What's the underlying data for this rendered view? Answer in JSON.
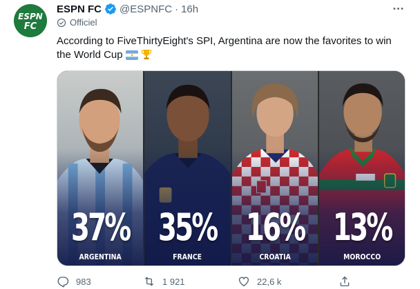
{
  "account": {
    "display_name": "ESPN FC",
    "handle": "@ESPNFC",
    "separator": "·",
    "time": "16h",
    "label": "Officiel",
    "avatar_text_top": "ESPN",
    "avatar_text_bottom": "FC"
  },
  "tweet": {
    "text": "According to FiveThirtyEight's SPI, Argentina are now the favorites to win the World Cup",
    "emojis": [
      "argentina-flag",
      "trophy"
    ]
  },
  "media": {
    "panels": [
      {
        "country": "ARGENTINA",
        "percent": "37%"
      },
      {
        "country": "FRANCE",
        "percent": "35%"
      },
      {
        "country": "CROATIA",
        "percent": "16%"
      },
      {
        "country": "MOROCCO",
        "percent": "13%"
      }
    ]
  },
  "actions": {
    "replies": "983",
    "retweets": "1 921",
    "likes": "22,6 k"
  },
  "colors": {
    "text": "#0f1419",
    "secondary": "#536471",
    "verified": "#1d9bf0",
    "espn_green": "#1f7a3d"
  }
}
